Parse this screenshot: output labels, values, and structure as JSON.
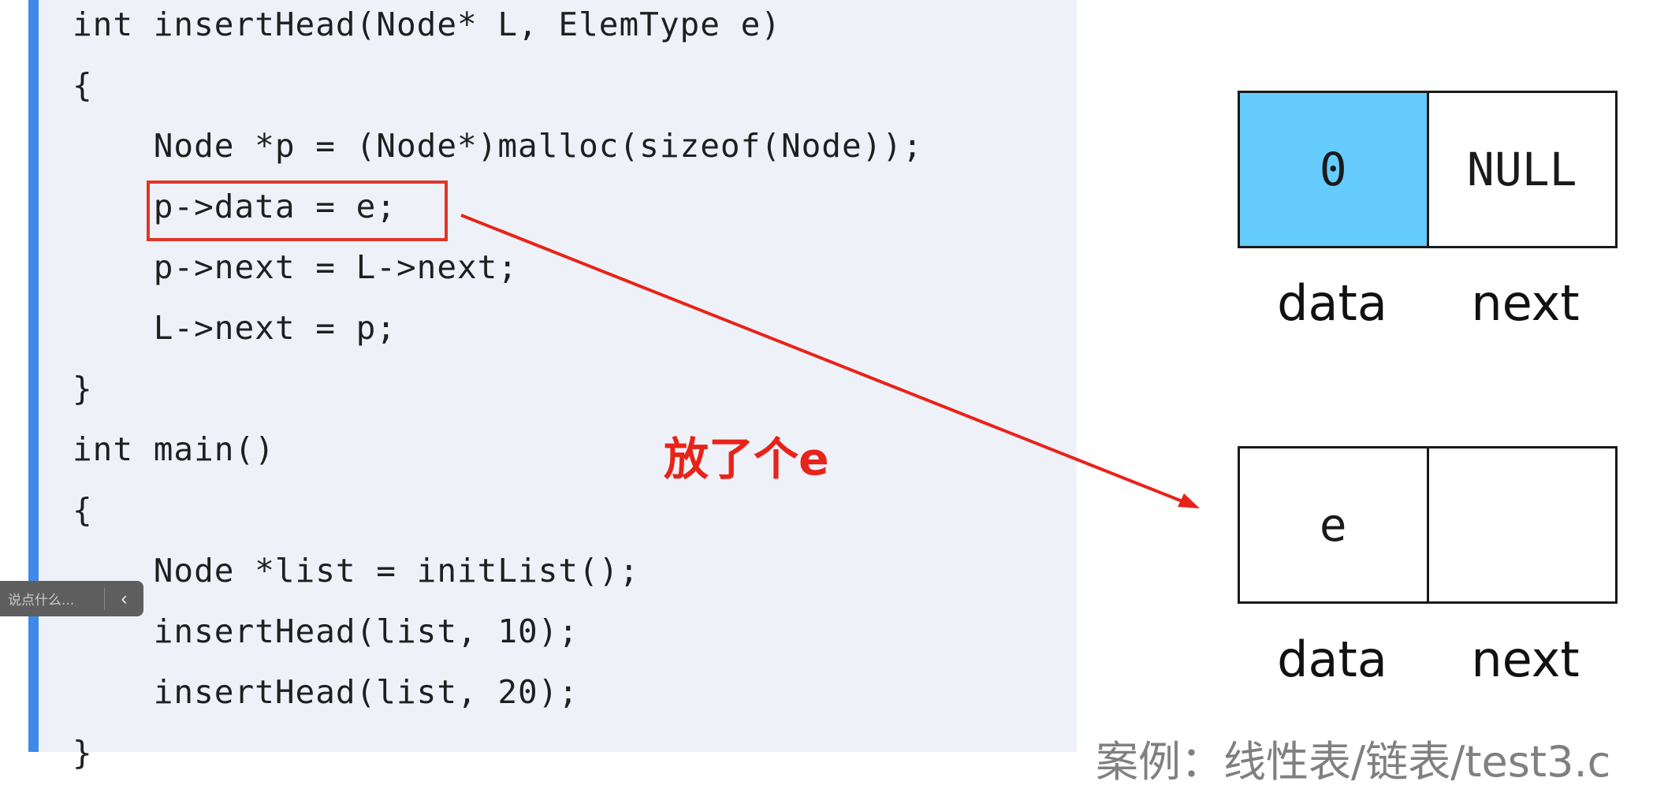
{
  "code": {
    "lines": [
      "int insertHead(Node* L, ElemType e)",
      "{",
      "    Node *p = (Node*)malloc(sizeof(Node));",
      "    p->data = e;",
      "    p->next = L->next;",
      "    L->next = p;",
      "}",
      "int main()",
      "{",
      "    Node *list = initList();",
      "    insertHead(list, 10);",
      "    insertHead(list, 20);",
      "}"
    ]
  },
  "annotation": {
    "text": "放了个e",
    "color": "#e8231a"
  },
  "diagram": {
    "head_node": {
      "data": "0",
      "next": "NULL",
      "data_fill": "#66ccfe"
    },
    "new_node": {
      "data": "e",
      "next": ""
    },
    "labels": {
      "data": "data",
      "next": "next"
    }
  },
  "footer": {
    "caption": "案例：线性表/链表/test3.c"
  },
  "comment_bubble": {
    "placeholder": "说点什么...",
    "collapse_icon": "chevron-left-icon"
  },
  "colors": {
    "accent": "#3d8ae8",
    "code_background": "#eef2f8",
    "highlight": "#e03528"
  }
}
